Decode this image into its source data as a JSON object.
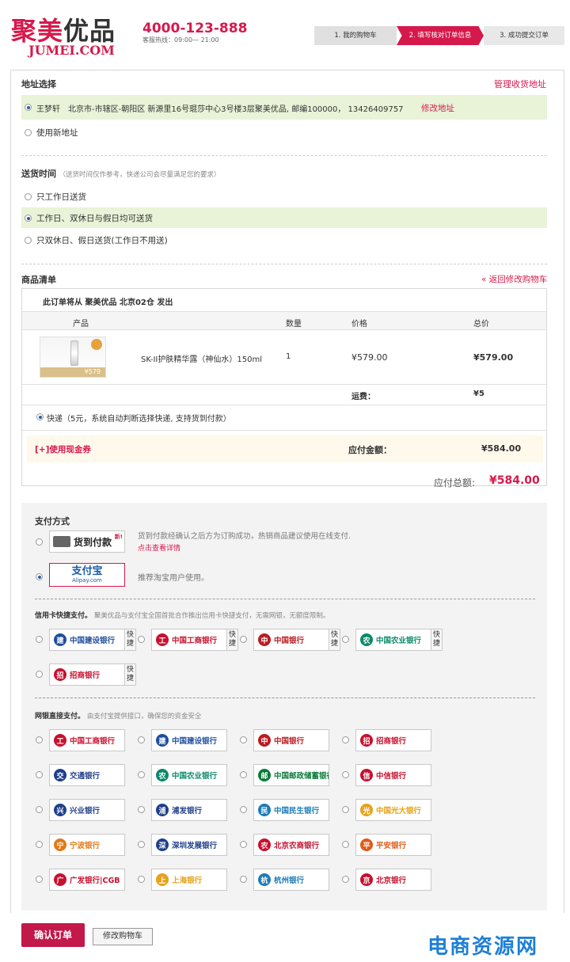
{
  "header": {
    "logo_cn_1": "聚美",
    "logo_cn_2": "优品",
    "logo_en": "JUMEI.COM",
    "hotline": "4000-123-888",
    "hotline_sub": "客服热线：09:00— 21:00",
    "steps": [
      "1. 我的购物车",
      "2. 填写核对订单信息",
      "3. 成功提交订单"
    ]
  },
  "address": {
    "title": "地址选择",
    "manage_link": "管理收货地址",
    "selected": "王梦轩　北京市-市辖区-朝阳区 新源里16号琨莎中心3号楼3层聚美优品, 邮编100000， 13426409757",
    "edit_link": "修改地址",
    "new_address": "使用新地址"
  },
  "delivery": {
    "title": "送货时间",
    "note": "（送货时间仅作参考，快递公司会尽量满足您的要求）",
    "options": [
      "只工作日送货",
      "工作日、双休日与假日均可送货",
      "只双休日、假日送货(工作日不用送)"
    ],
    "selected_index": 1
  },
  "goods": {
    "title": "商品清单",
    "back_link": "« 返回修改购物车",
    "ship_from": "此订单将从 聚美优品 北京02仓 发出",
    "headers": [
      "产品",
      "数量",
      "价格",
      "总价"
    ],
    "item": {
      "name": "SK-II护肤精华露（神仙水）150ml",
      "qty": "1",
      "price": "¥579.00",
      "total": "¥579.00",
      "thumb_price": "¥579"
    },
    "shipping_label": "运费：",
    "shipping_value": "¥5",
    "express": "快递（5元，系统自动判断选择快递, 支持货到付款）",
    "coupon_link": "[+]使用现金券",
    "payable_label": "应付金额：",
    "payable_value": "¥584.00",
    "total_label": "应付总额:",
    "total_value": "¥584.00"
  },
  "payment": {
    "title": "支付方式",
    "cod_label": "货到付款",
    "cod_new": "新!",
    "cod_desc": "货到付款经确认之后方为订购成功，热销商品建议使用在线支付.",
    "cod_link": "点击查看详情",
    "alipay_label": "支付宝",
    "alipay_sub": "Alipay.com",
    "alipay_desc": "推荐淘宝用户使用。",
    "credit_title": "信用卡快捷支付。",
    "credit_desc": "聚美优品与支付宝全国首批合作推出信用卡快捷支付，无需网银，无额度限制。",
    "quick_label": "快捷",
    "credit_banks": [
      {
        "name": "中国建设银行",
        "color": "#1f4e9c",
        "mark": "建"
      },
      {
        "name": "中国工商银行",
        "color": "#c8102e",
        "mark": "工"
      },
      {
        "name": "中国银行",
        "color": "#b81c22",
        "mark": "中"
      },
      {
        "name": "中国农业银行",
        "color": "#0a8a6a",
        "mark": "农"
      },
      {
        "name": "招商银行",
        "color": "#c8102e",
        "mark": "招"
      }
    ],
    "netbank_title": "网银直接支付。",
    "netbank_desc": "由支付宝提供接口，确保您的资金安全",
    "net_banks": [
      {
        "name": "中国工商银行",
        "color": "#c8102e",
        "mark": "工"
      },
      {
        "name": "中国建设银行",
        "color": "#1f4e9c",
        "mark": "建"
      },
      {
        "name": "中国银行",
        "color": "#b81c22",
        "mark": "中"
      },
      {
        "name": "招商银行",
        "color": "#c8102e",
        "mark": "招"
      },
      {
        "name": "交通银行",
        "color": "#1f3f8a",
        "mark": "交"
      },
      {
        "name": "中国农业银行",
        "color": "#0a8a6a",
        "mark": "农"
      },
      {
        "name": "中国邮政储蓄银行",
        "color": "#0a7a3a",
        "mark": "邮"
      },
      {
        "name": "中信银行",
        "color": "#c8102e",
        "mark": "信"
      },
      {
        "name": "兴业银行",
        "color": "#1f3f8a",
        "mark": "兴"
      },
      {
        "name": "浦发银行",
        "color": "#1f3f8a",
        "mark": "浦"
      },
      {
        "name": "中国民生银行",
        "color": "#1b7bb8",
        "mark": "民"
      },
      {
        "name": "中国光大银行",
        "color": "#e6a21b",
        "mark": "光"
      },
      {
        "name": "宁波银行",
        "color": "#e07b1a",
        "mark": "宁"
      },
      {
        "name": "深圳发展银行",
        "color": "#1f3f8a",
        "mark": "深"
      },
      {
        "name": "北京农商银行",
        "color": "#c8102e",
        "mark": "农"
      },
      {
        "name": "平安银行",
        "color": "#e05a1a",
        "mark": "平"
      },
      {
        "name": "广发银行|CGB",
        "color": "#c8102e",
        "mark": "广"
      },
      {
        "name": "上海银行",
        "color": "#e6a21b",
        "mark": "上"
      },
      {
        "name": "杭州银行",
        "color": "#1b7bb8",
        "mark": "杭"
      },
      {
        "name": "北京银行",
        "color": "#c8102e",
        "mark": "京"
      }
    ]
  },
  "actions": {
    "confirm": "确认订单",
    "modify": "修改购物车"
  },
  "watermark": "电商资源网"
}
